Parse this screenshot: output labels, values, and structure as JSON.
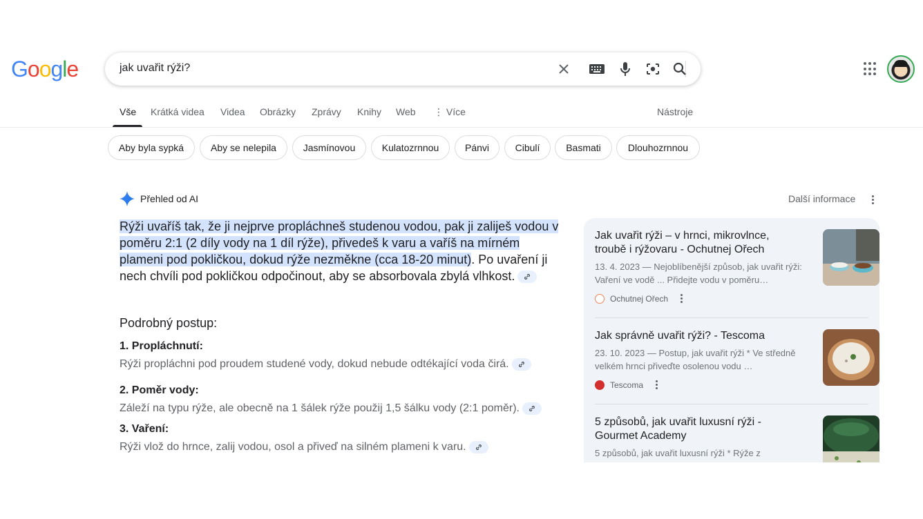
{
  "logo": {
    "letters": [
      "G",
      "o",
      "o",
      "g",
      "l",
      "e"
    ],
    "colors": [
      "#4285f4",
      "#ea4335",
      "#fbbc05",
      "#4285f4",
      "#34a853",
      "#ea4335"
    ]
  },
  "search": {
    "query": "jak uvařit rýži?"
  },
  "tabs": [
    {
      "label": "Vše",
      "active": true
    },
    {
      "label": "Krátká videa"
    },
    {
      "label": "Videa"
    },
    {
      "label": "Obrázky"
    },
    {
      "label": "Zprávy"
    },
    {
      "label": "Knihy"
    },
    {
      "label": "Web"
    },
    {
      "label": "Více"
    }
  ],
  "tools_label": "Nástroje",
  "chips": [
    "Aby byla sypká",
    "Aby se nelepila",
    "Jasmínovou",
    "Kulatozrnnou",
    "Pánvi",
    "Cibulí",
    "Basmati",
    "Dlouhozrnnou"
  ],
  "ai_overview": {
    "title": "Přehled od AI",
    "more_info": "Další informace",
    "summary_highlighted": "Rýži uvaříš tak, že ji nejprve propláchneš studenou vodou, pak ji zaliješ vodou v poměru 2:1 (2 díly vody na 1 díl rýže), přivedeš k varu a vaříš na mírném plameni pod pokličkou, dokud rýže nezměkne (cca 18-20 minut)",
    "summary_rest": ". Po uvaření ji nech chvíli pod pokličkou odpočinout, aby se absorbovala zbylá vlhkost.",
    "subheading": "Podrobný postup:",
    "steps": [
      {
        "title": "1. Propláchnutí:",
        "text": "Rýži propláchni pod proudem studené vody, dokud nebude odtékající voda čirá."
      },
      {
        "title": "2. Poměr vody:",
        "text": "Záleží na typu rýže, ale obecně na 1 šálek rýže použij 1,5 šálku vody (2:1 poměr)."
      },
      {
        "title": "3. Vaření:",
        "text": "Rýži vlož do hrnce, zalij vodou, osol a přiveď na silném plameni k varu."
      }
    ]
  },
  "sources": [
    {
      "title": "Jak uvařit rýži – v hrnci, mikrovlnce, troubě i rýžovaru - Ochutnej Ořech",
      "desc": "13. 4. 2023 — Nejoblíbenější způsob, jak uvařit rýži: Vaření ve vodě ... Přidejte vodu v poměru…",
      "site": "Ochutnej Ořech"
    },
    {
      "title": "Jak správně uvařit rýži? - Tescoma",
      "desc": "23. 10. 2023 — Postup, jak uvařit rýži * Ve středně velkém hrnci přiveďte osolenou vodu …",
      "site": "Tescoma"
    },
    {
      "title": "5 způsobů, jak uvařit luxusní rýži - Gourmet Academy",
      "desc": "5 způsobů, jak uvařit luxusní rýži * Rýže z",
      "site": ""
    }
  ]
}
